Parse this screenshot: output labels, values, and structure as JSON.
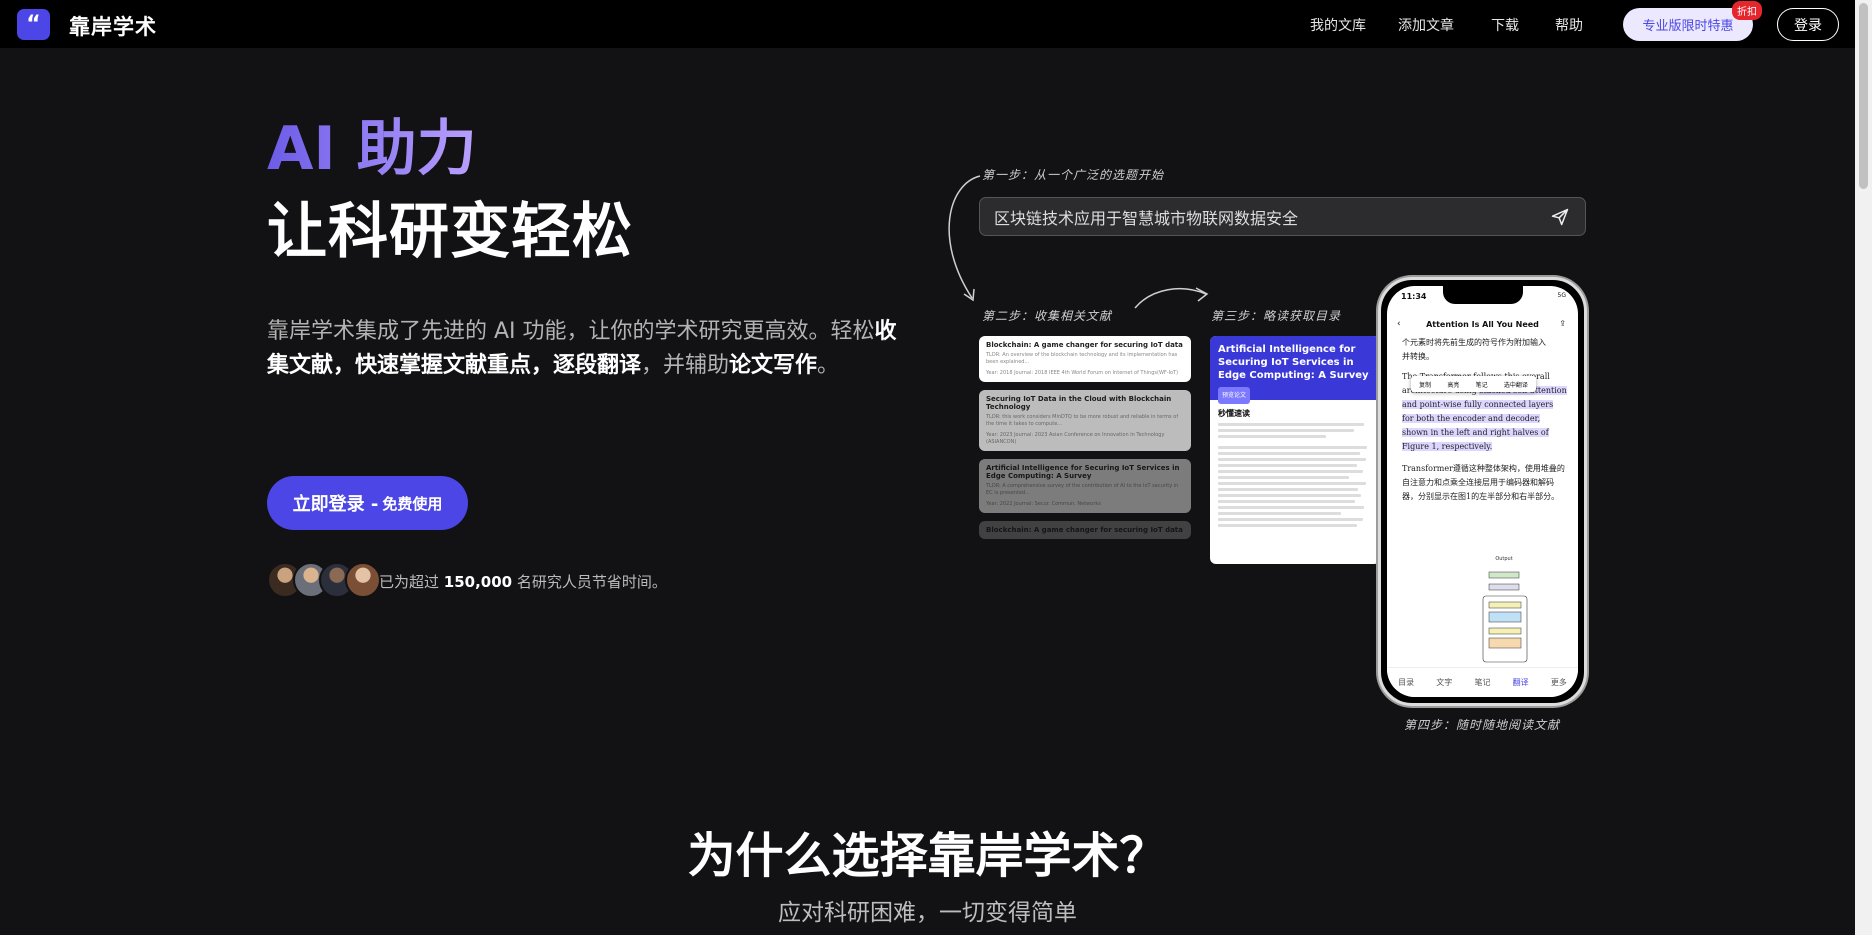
{
  "nav": {
    "logo_glyph": "“",
    "brand": "靠岸学术",
    "links": [
      "我的文库",
      "添加文章",
      "下载",
      "帮助"
    ],
    "pro_button": "专业版限时特惠",
    "discount_badge": "折扣",
    "login": "登录"
  },
  "hero": {
    "headline_accent": "AI 助力",
    "headline_main": "让科研变轻松",
    "desc_prefix": "靠岸学术集成了先进的 AI 功能，让你的学术研究更高效。轻松",
    "desc_b1": "收集文献，快速掌握文献重点，逐段翻译",
    "desc_mid": "，并辅助",
    "desc_b2": "论文写作",
    "desc_end": "。",
    "cta_main": "立即登录 -",
    "cta_free": "免费使用",
    "users_prefix": "已为超过",
    "users_count": "150,000",
    "users_suffix": "名研究人员节省时间。"
  },
  "steps": {
    "step1": "第一步：从一个广泛的选题开始",
    "step2": "第二步：收集相关文献",
    "step3": "第三步：略读获取目录",
    "step4": "第四步：随时随地阅读文献",
    "search_value": "区块链技术应用于智慧城市物联网数据安全"
  },
  "cards": [
    {
      "title": "Blockchain: A game changer for securing IoT data",
      "summary": "TLDR: An overview of the blockchain technology and its implementation has been explained...",
      "meta": "Year: 2018 Journal: 2018 IEEE 4th World Forum on Internet of Things(WF-IoT)"
    },
    {
      "title": "Securing IoT Data in the Cloud with Blockchain Technology",
      "summary": "TLDR: this work considers MinDTQ to be more robust and reliable in terms of the time it takes to compute...",
      "meta": "Year: 2023 Journal: 2023 Asian Conference on Innovation in Technology (ASIANCON)"
    },
    {
      "title": "Artificial Intelligence for Securing IoT Services in Edge Computing: A Survey",
      "summary": "TLDR: A comprehensive survey of the contribution of AI to the IoT security in EC is presented...",
      "meta": "Year: 2022 Journal: Secur. Commun. Networks"
    },
    {
      "title": "Blockchain: A game changer for securing IoT data",
      "summary": "",
      "meta": ""
    }
  ],
  "paper": {
    "title": "Artificial Intelligence for Securing IoT Services in Edge Computing: A Survey",
    "tag": "预览论文",
    "section": "秒懂速读"
  },
  "phone": {
    "time": "11:34",
    "status": "5G",
    "title": "Attention Is All You Need",
    "menu": [
      "复制",
      "高亮",
      "笔记",
      "选中翻译"
    ],
    "text_1": "个元素时将先前生成的符号作为附加输入",
    "text_2": "并转换。",
    "text_3a": "The Transformer follows this overall",
    "text_3b": "architecture using ",
    "text_3c": "stacked self-attention and point-wise",
    "text_3d": " fully connected layers for both the encoder and decoder, shown in the left and right halves of Figure 1, respectively.",
    "text_4": "Transformer遵循这种整体架构，使用堆叠的自注意力和点乘全连接层用于编码器和解码器，分别显示在图1的左半部分和右半部分。",
    "diagram_label": "Output Probabilities",
    "tabs": [
      "目录",
      "文字",
      "笔记",
      "翻译",
      "更多"
    ]
  },
  "why": {
    "title": "为什么选择靠岸学术？",
    "subtitle": "应对科研困难，一切变得简单"
  },
  "colors": {
    "accent": "#4b46e5",
    "background": "#121113",
    "gradient_start": "#6c5ce7",
    "gradient_end": "#b9a0ff"
  }
}
